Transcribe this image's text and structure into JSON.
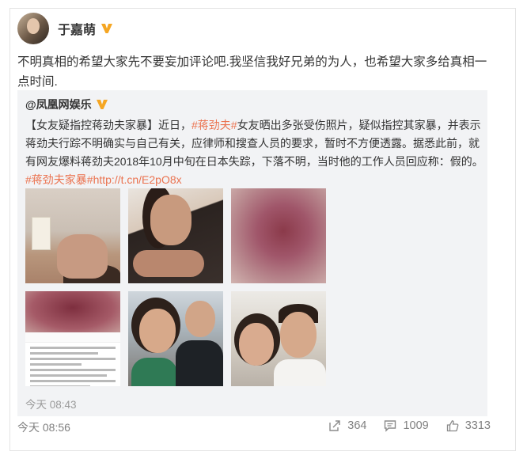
{
  "post": {
    "author": "于嘉萌",
    "text": "不明真相的希望大家先不要妄加评论吧.我坚信我好兄弟的为人，也希望大家多给真相一点时间.",
    "time": "今天 08:56"
  },
  "repost": {
    "author": "@凤凰网娱乐",
    "text_parts": {
      "p1": "【女友疑指控蒋劲夫家暴】近日，",
      "tag1": "#蒋劲夫#",
      "p2": "女友晒出多张受伤照片，疑似指控其家暴，并表示蒋劲夫行踪不明确实与自己有关，应律师和搜查人员的要求，暂时不方便透露。据悉此前，就有网友爆料蒋劲夫2018年10月中旬在日本失踪，下落不明，当时他的工作人员回应称：假的。",
      "tag2": "#蒋劲夫家暴#",
      "link": "http://t.cn/E2pO8x"
    },
    "time": "今天 08:43",
    "photo_icons": [
      "bruised-face-photo",
      "injured-arm-photo",
      "bruise-closeup-photo",
      "bruise-screenshot-photo",
      "couple-selfie-photo",
      "couple-photo"
    ]
  },
  "actions": {
    "share_count": "364",
    "comment_count": "1009",
    "like_count": "3313"
  },
  "colors": {
    "accent": "#eb7350",
    "verified": "#f5a623",
    "repost_bg": "#f2f3f5"
  }
}
